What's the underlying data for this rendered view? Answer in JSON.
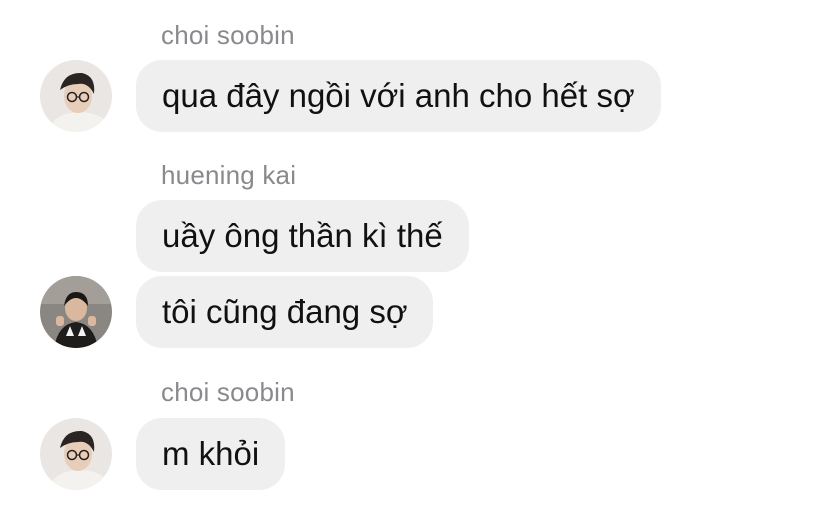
{
  "messages": [
    {
      "sender": "choi soobin",
      "bubbles": [
        "qua đây ngồi với anh cho hết sợ"
      ],
      "avatar": "person-with-glasses-avatar"
    },
    {
      "sender": "huening kai",
      "bubbles": [
        "uầy ông thần kì thế",
        "tôi cũng đang sợ"
      ],
      "avatar": "person-dark-hair-avatar"
    },
    {
      "sender": "choi soobin",
      "bubbles": [
        "m khỏi"
      ],
      "avatar": "person-with-glasses-avatar"
    }
  ],
  "colors": {
    "bubble_bg": "#efeff0",
    "sender_text": "#8a8a8e",
    "message_text": "#111111",
    "background": "#ffffff"
  }
}
